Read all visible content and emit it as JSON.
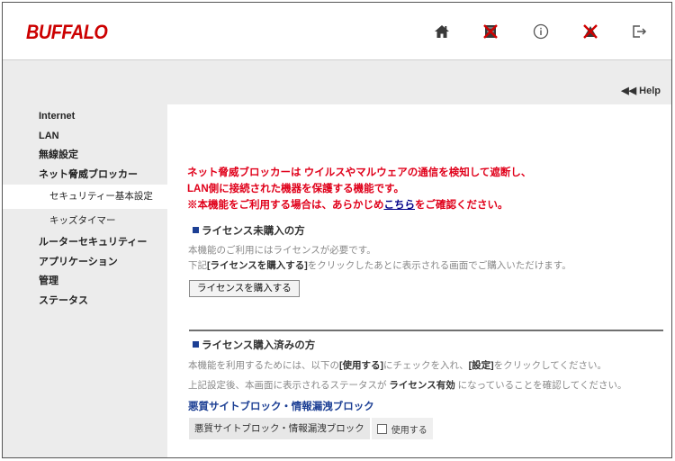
{
  "header": {
    "logo": "BUFFALO",
    "icons": [
      "home-icon",
      "cross-status-icon",
      "info-icon",
      "alert-status-icon",
      "logout-icon"
    ]
  },
  "help": {
    "label": "◀◀ Help"
  },
  "sidebar": {
    "items": [
      {
        "label": "Internet"
      },
      {
        "label": "LAN"
      },
      {
        "label": "無線設定"
      },
      {
        "label": "ネット脅威ブロッカー"
      },
      {
        "label": "セキュリティー基本設定"
      },
      {
        "label": "キッズタイマー"
      },
      {
        "label": "ルーターセキュリティー"
      },
      {
        "label": "アプリケーション"
      },
      {
        "label": "管理"
      },
      {
        "label": "ステータス"
      }
    ]
  },
  "main": {
    "notice_line1": "ネット脅威ブロッカーは ウイルスやマルウェアの通信を検知して遮断し、",
    "notice_line2": "LAN側に接続された機器を保護する機能です。",
    "notice_line3_pre": "※本機能をご利用する場合は、あらかじめ",
    "notice_link": "こちら",
    "notice_line3_post": "をご確認ください。",
    "section1": {
      "title": "ライセンス未購入の方",
      "para1": "本機能のご利用にはライセンスが必要です。",
      "para2_pre": "下記",
      "para2_bold": "[ライセンスを購入する]",
      "para2_post": "をクリックしたあとに表示される画面でご購入いただけます。",
      "button": "ライセンスを購入する"
    },
    "section2": {
      "title": "ライセンス購入済みの方",
      "para1_pre": "本機能を利用するためには、以下の",
      "para1_bold1": "[使用する]",
      "para1_mid": "にチェックを入れ、",
      "para1_bold2": "[設定]",
      "para1_post": "をクリックしてください。",
      "para2_pre": "上記設定後、本画面に表示されるステータスが ",
      "para2_bold": "ライセンス有効",
      "para2_post": " になっていることを確認してください。",
      "subheading": "悪質サイトブロック・情報漏洩ブロック",
      "row_label": "悪質サイトブロック・情報漏洩ブロック",
      "checkbox_label": "使用する",
      "checkbox_checked": false
    }
  },
  "colors": {
    "brand": "#cc0000",
    "notice": "#e0001a",
    "heading_square": "#1c3f94",
    "link": "#000088"
  }
}
